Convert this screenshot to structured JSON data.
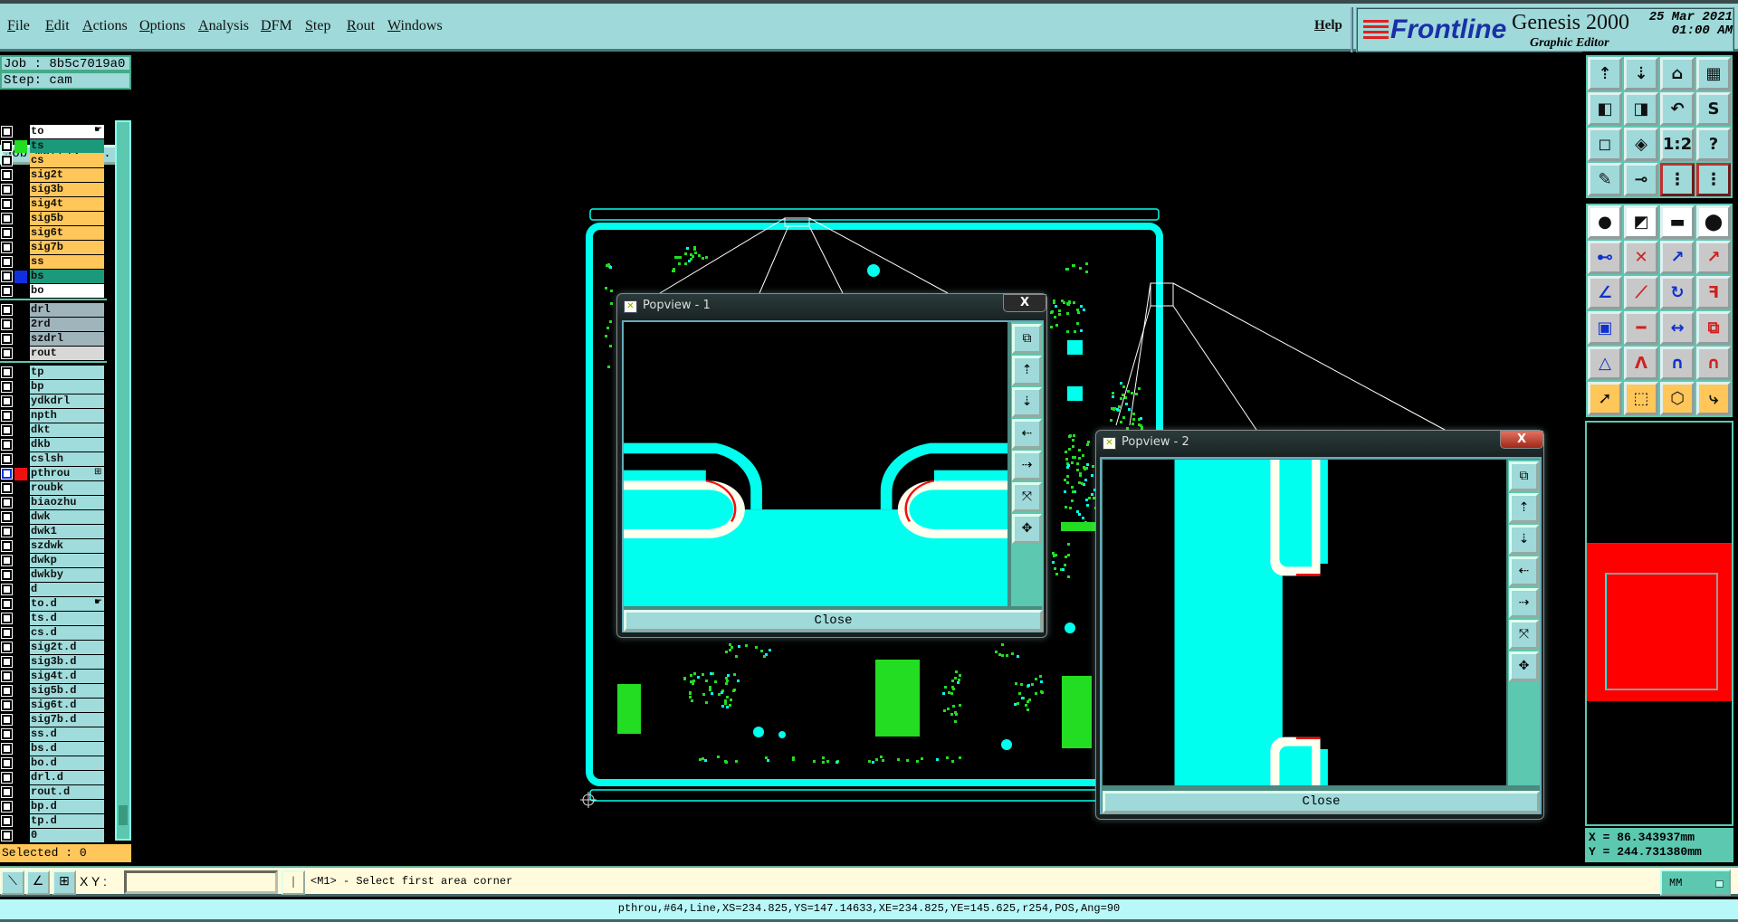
{
  "menu": {
    "items": [
      "File",
      "Edit",
      "Actions",
      "Options",
      "Analysis",
      "DFM",
      "Step",
      "Rout",
      "Windows"
    ],
    "help": "Help"
  },
  "logo": {
    "brand": "Frontline",
    "product": "Genesis 2000",
    "subtitle": "Graphic Editor",
    "date": "25 Mar 2021",
    "time": "01:00 AM"
  },
  "job": {
    "job_line": "Job : 8b5c7019a0",
    "step_line": "Step: cam",
    "matrix_button": "Job Matrix ..."
  },
  "layers": [
    {
      "name": "to",
      "bg": "#ffffff",
      "swatch": null,
      "mark": "hand",
      "group": 1
    },
    {
      "name": "ts",
      "bg": "#1a9a7a",
      "swatch": "#22dd22",
      "group": 1
    },
    {
      "name": "cs",
      "bg": "#ffc65a",
      "group": 1
    },
    {
      "name": "sig2t",
      "bg": "#ffc65a",
      "group": 1
    },
    {
      "name": "sig3b",
      "bg": "#ffc65a",
      "group": 1
    },
    {
      "name": "sig4t",
      "bg": "#ffc65a",
      "group": 1
    },
    {
      "name": "sig5b",
      "bg": "#ffc65a",
      "group": 1
    },
    {
      "name": "sig6t",
      "bg": "#ffc65a",
      "group": 1
    },
    {
      "name": "sig7b",
      "bg": "#ffc65a",
      "group": 1
    },
    {
      "name": "ss",
      "bg": "#ffc65a",
      "group": 1
    },
    {
      "name": "bs",
      "bg": "#1a9a7a",
      "swatch": "#1030e0",
      "group": 1
    },
    {
      "name": "bo",
      "bg": "#ffffff",
      "group": 1
    },
    {
      "name": "drl",
      "bg": "#a0b4bc",
      "group": 2
    },
    {
      "name": "2rd",
      "bg": "#a0b4bc",
      "group": 2
    },
    {
      "name": "szdrl",
      "bg": "#a0b4bc",
      "group": 2
    },
    {
      "name": "rout",
      "bg": "#d8d8d8",
      "group": 2
    },
    {
      "name": "tp",
      "bg": "#a0dcdc",
      "group": 3
    },
    {
      "name": "bp",
      "bg": "#a0dcdc",
      "group": 3
    },
    {
      "name": "ydkdrl",
      "bg": "#a0dcdc",
      "group": 3
    },
    {
      "name": "npth",
      "bg": "#a0dcdc",
      "group": 3
    },
    {
      "name": "dkt",
      "bg": "#a0dcdc",
      "group": 3
    },
    {
      "name": "dkb",
      "bg": "#a0dcdc",
      "group": 3
    },
    {
      "name": "cslsh",
      "bg": "#a0dcdc",
      "group": 3
    },
    {
      "name": "pthrou",
      "bg": "#a0dcdc",
      "swatch": "#ee1010",
      "mark": "plus",
      "active": true,
      "group": 3
    },
    {
      "name": "roubk",
      "bg": "#a0dcdc",
      "group": 3
    },
    {
      "name": "biaozhu",
      "bg": "#a0dcdc",
      "group": 3
    },
    {
      "name": "dwk",
      "bg": "#a0dcdc",
      "group": 3
    },
    {
      "name": "dwk1",
      "bg": "#a0dcdc",
      "group": 3
    },
    {
      "name": "szdwk",
      "bg": "#a0dcdc",
      "group": 3
    },
    {
      "name": "dwkp",
      "bg": "#a0dcdc",
      "group": 3
    },
    {
      "name": "dwkby",
      "bg": "#a0dcdc",
      "group": 3
    },
    {
      "name": "d",
      "bg": "#a0dcdc",
      "group": 3
    },
    {
      "name": "to.d",
      "bg": "#a0dcdc",
      "mark": "hand",
      "group": 3
    },
    {
      "name": "ts.d",
      "bg": "#a0dcdc",
      "group": 3
    },
    {
      "name": "cs.d",
      "bg": "#a0dcdc",
      "group": 3
    },
    {
      "name": "sig2t.d",
      "bg": "#a0dcdc",
      "group": 3
    },
    {
      "name": "sig3b.d",
      "bg": "#a0dcdc",
      "group": 3
    },
    {
      "name": "sig4t.d",
      "bg": "#a0dcdc",
      "group": 3
    },
    {
      "name": "sig5b.d",
      "bg": "#a0dcdc",
      "group": 3
    },
    {
      "name": "sig6t.d",
      "bg": "#a0dcdc",
      "group": 3
    },
    {
      "name": "sig7b.d",
      "bg": "#a0dcdc",
      "group": 3
    },
    {
      "name": "ss.d",
      "bg": "#a0dcdc",
      "group": 3
    },
    {
      "name": "bs.d",
      "bg": "#a0dcdc",
      "group": 3
    },
    {
      "name": "bo.d",
      "bg": "#a0dcdc",
      "group": 3
    },
    {
      "name": "drl.d",
      "bg": "#a0dcdc",
      "group": 3
    },
    {
      "name": "rout.d",
      "bg": "#a0dcdc",
      "group": 3
    },
    {
      "name": "bp.d",
      "bg": "#a0dcdc",
      "group": 3
    },
    {
      "name": "tp.d",
      "bg": "#a0dcdc",
      "group": 3
    },
    {
      "name": "0",
      "bg": "#a0dcdc",
      "group": 3
    }
  ],
  "selected": "Selected : 0",
  "toolbar": {
    "groups": [
      {
        "style": "teal",
        "icons": [
          [
            "zoom-layer-up-icon",
            "⇡"
          ],
          [
            "zoom-layer-down-icon",
            "⇣"
          ],
          [
            "home-icon",
            "⌂"
          ],
          [
            "grid-xy-icon",
            "▦"
          ],
          [
            "pan-left-icon",
            "◧"
          ],
          [
            "pan-right-icon",
            "◨"
          ],
          [
            "undo-view-icon",
            "↶"
          ],
          [
            "route-snake-icon",
            "S"
          ],
          [
            "fit-all-icon",
            "◻"
          ],
          [
            "fit-profile-icon",
            "◈"
          ],
          [
            "scale-1-2-icon",
            "1:2"
          ],
          [
            "help-icon",
            "?"
          ],
          [
            "tools-palette-icon",
            "✎"
          ],
          [
            "snap-icon",
            "⊸"
          ],
          [
            "net-highlight-icon",
            "⋮"
          ],
          [
            "net-highlight-alt-icon",
            "⋮"
          ]
        ]
      },
      {
        "style": "mixed",
        "icons": [
          [
            "add-feature-icon",
            "●"
          ],
          [
            "select-area-icon",
            "◩"
          ],
          [
            "measure-ruler-icon",
            "▬"
          ],
          [
            "pad-icon",
            "⬤"
          ],
          [
            "connect-nodes-icon",
            "⊷"
          ],
          [
            "delete-node-icon",
            "✕"
          ],
          [
            "move-to-pad-icon",
            "↗"
          ],
          [
            "move-pad-icon",
            "↗"
          ],
          [
            "line-angle-icon",
            "∠"
          ],
          [
            "line-move-icon",
            "⟋"
          ],
          [
            "rotate-icon",
            "↻"
          ],
          [
            "mirror-icon",
            "ꟻ"
          ],
          [
            "snap-pad-icon",
            "▣"
          ],
          [
            "line-segment-icon",
            "━"
          ],
          [
            "dimension-icon",
            "↔"
          ],
          [
            "pads-group-icon",
            "⧉"
          ],
          [
            "arc-triangle-icon",
            "△"
          ],
          [
            "arc-peak-icon",
            "Λ"
          ],
          [
            "arc-bridge-icon",
            "∩"
          ],
          [
            "arc-cross-icon",
            "∩"
          ],
          [
            "select-pointer-icon",
            "➚"
          ],
          [
            "select-box-icon",
            "⬚"
          ],
          [
            "select-polygon-icon",
            "⬡"
          ],
          [
            "select-net-icon",
            "⤷"
          ]
        ]
      }
    ]
  },
  "coords": {
    "x": "X = 86.343937mm",
    "y": "Y = 244.731380mm"
  },
  "command": {
    "xy_label": "X Y :",
    "xy_value": "",
    "message": "<M1> - Select first area corner",
    "units": "MM"
  },
  "status": "pthrou,#64,Line,XS=234.825,YS=147.14633,XE=234.825,YE=145.625,r254,POS,Ang=90",
  "popups": [
    {
      "title": "Popview - 1",
      "close": "Close",
      "x_label": "X"
    },
    {
      "title": "Popview - 2",
      "close": "Close",
      "x_label": "X"
    }
  ],
  "colors": {
    "copper": "#00ffee",
    "silk": "#fffff0",
    "drc": "#ee1010",
    "comp": "#22dd22",
    "panel": "#9fd9d9"
  }
}
